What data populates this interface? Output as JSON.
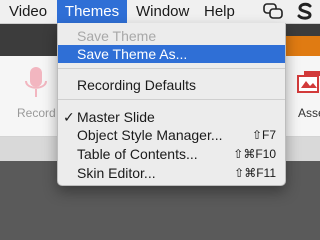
{
  "menubar": {
    "items": [
      "Video",
      "Themes",
      "Window",
      "Help"
    ],
    "active_item": "Themes",
    "icons": [
      "chat-bubbles-icon",
      "app-logo-icon"
    ]
  },
  "ribbon": {
    "record_label": "Record",
    "assets_label": "Asse"
  },
  "themes_menu": {
    "save_theme": "Save Theme",
    "save_theme_as": "Save Theme As...",
    "recording_defaults": "Recording Defaults",
    "master_slide": "Master Slide",
    "master_slide_checked": true,
    "object_style_manager": "Object Style Manager...",
    "object_style_manager_shortcut": "⇧F7",
    "table_of_contents": "Table of Contents...",
    "table_of_contents_shortcut": "⇧⌘F10",
    "skin_editor": "Skin Editor...",
    "skin_editor_shortcut": "⇧⌘F11",
    "check_mark": "✓"
  },
  "colors": {
    "highlight": "#2f6fd6",
    "toolbar_dark": "#3c3c3c",
    "accent_orange": "#e07b12"
  }
}
